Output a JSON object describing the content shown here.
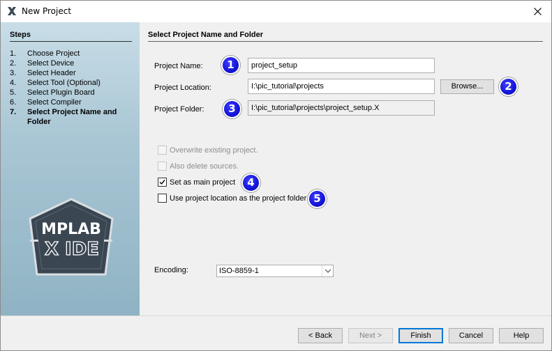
{
  "window": {
    "title": "New Project"
  },
  "steps": {
    "title": "Steps",
    "items": [
      {
        "num": "1.",
        "label": "Choose Project"
      },
      {
        "num": "2.",
        "label": "Select Device"
      },
      {
        "num": "3.",
        "label": "Select Header"
      },
      {
        "num": "4.",
        "label": "Select Tool (Optional)"
      },
      {
        "num": "5.",
        "label": "Select Plugin Board"
      },
      {
        "num": "6.",
        "label": "Select Compiler"
      },
      {
        "num": "7.",
        "label": "Select Project Name and Folder"
      }
    ],
    "logo_text": "MPLAB X IDE"
  },
  "main": {
    "title": "Select Project Name and Folder",
    "project_name_label": "Project Name:",
    "project_name_value": "project_setup",
    "project_location_label": "Project Location:",
    "project_location_value": "I:\\pic_tutorial\\projects",
    "browse_label": "Browse...",
    "project_folder_label": "Project Folder:",
    "project_folder_value": "I:\\pic_tutorial\\projects\\project_setup.X",
    "overwrite_label": "Overwrite existing project.",
    "delete_sources_label": "Also delete sources.",
    "main_project_label": "Set as main project",
    "use_location_label": "Use project location as the project folder",
    "encoding_label": "Encoding:",
    "encoding_value": "ISO-8859-1"
  },
  "badges": [
    "1",
    "2",
    "3",
    "4",
    "5"
  ],
  "footer": {
    "back_label": "< Back",
    "next_label": "Next >",
    "finish_label": "Finish",
    "cancel_label": "Cancel",
    "help_label": "Help"
  },
  "colors": {
    "badge": "#1414d8",
    "accent": "#0078d7"
  }
}
